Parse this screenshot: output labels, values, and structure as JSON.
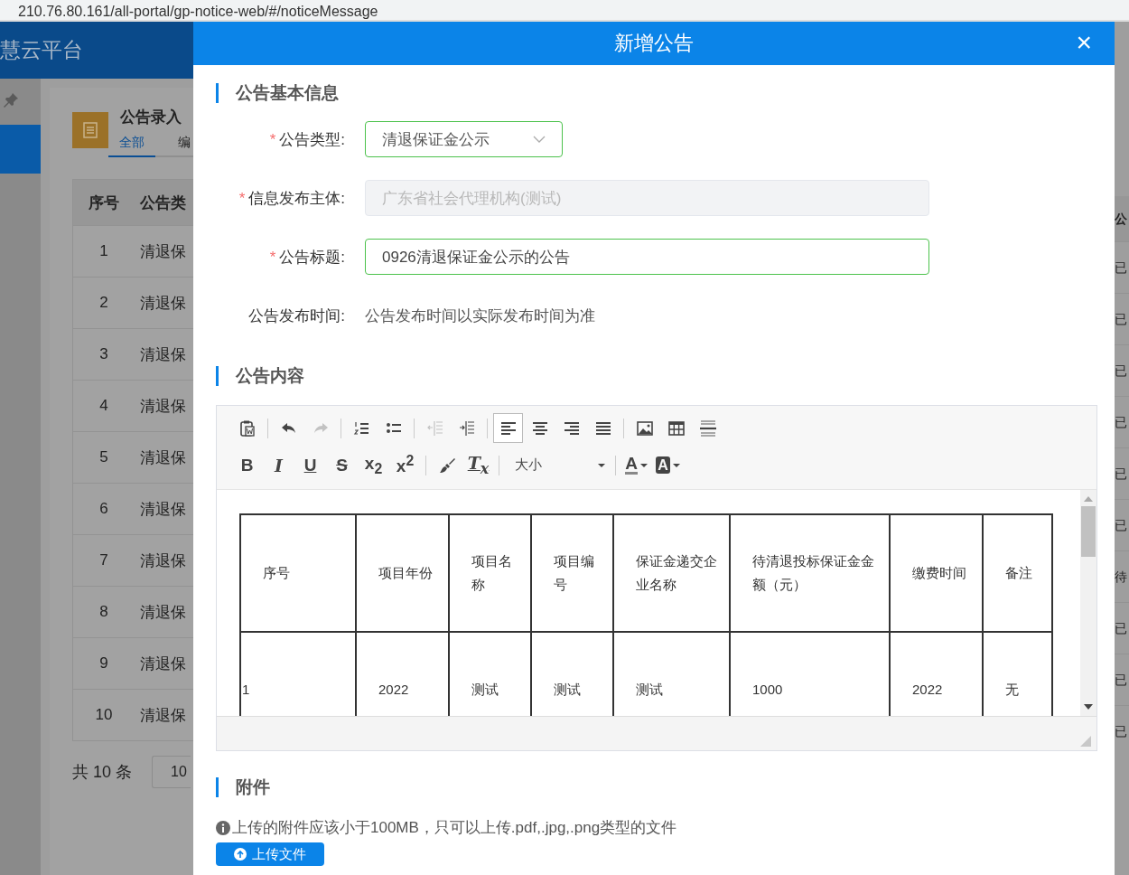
{
  "browser": {
    "url": "210.76.80.161/all-portal/gp-notice-web/#/noticeMessage"
  },
  "background": {
    "app_title": "慧云平台",
    "page_title": "公告录入",
    "tabs": [
      {
        "label": "全部",
        "selected": true
      },
      {
        "label": "编",
        "selected": false
      }
    ],
    "table": {
      "columns": [
        "序号",
        "公告类"
      ],
      "rows": [
        [
          "1",
          "清退保"
        ],
        [
          "2",
          "清退保"
        ],
        [
          "3",
          "清退保"
        ],
        [
          "4",
          "清退保"
        ],
        [
          "5",
          "清退保"
        ],
        [
          "6",
          "清退保"
        ],
        [
          "7",
          "清退保"
        ],
        [
          "8",
          "清退保"
        ],
        [
          "9",
          "清退保"
        ],
        [
          "10",
          "清退保"
        ]
      ],
      "right_column_header": "公",
      "right_column": [
        "已",
        "已",
        "已",
        "已",
        "已",
        "已",
        "待",
        "已",
        "已",
        "已"
      ]
    },
    "pagination": {
      "total": "共 10 条",
      "page_size": "10"
    }
  },
  "dialog": {
    "title": "新增公告",
    "close": "×",
    "sections": [
      "公告基本信息",
      "公告内容",
      "附件"
    ],
    "form": [
      {
        "kind": "select",
        "label": "公告类型:",
        "required_mark": "*",
        "value": "清退保证金公示"
      },
      {
        "kind": "disabled",
        "label": "信息发布主体:",
        "required_mark": "*",
        "value": "广东省社会代理机构(测试)"
      },
      {
        "kind": "input",
        "label": "公告标题:",
        "required_mark": "*",
        "value": "0926清退保证金公示的公告"
      },
      {
        "kind": "text",
        "label": "公告发布时间:",
        "value": "公告发布时间以实际发布时间为准"
      }
    ],
    "editor": {
      "toolbar": [
        [
          [
            {
              "kind": "paste-word",
              "selected": false,
              "disabled": false
            }
          ],
          [
            {
              "kind": "undo",
              "selected": false,
              "disabled": false
            },
            {
              "kind": "redo",
              "selected": false,
              "disabled": true
            }
          ],
          [
            {
              "kind": "ordered-list",
              "selected": false,
              "disabled": false
            },
            {
              "kind": "bullet-list",
              "selected": false,
              "disabled": false
            }
          ],
          [
            {
              "kind": "outdent",
              "selected": false,
              "disabled": true
            },
            {
              "kind": "indent",
              "selected": false,
              "disabled": false
            }
          ],
          [
            {
              "kind": "align-left",
              "selected": true,
              "disabled": false
            },
            {
              "kind": "align-center",
              "selected": false,
              "disabled": false
            },
            {
              "kind": "align-right",
              "selected": false,
              "disabled": false
            },
            {
              "kind": "justify",
              "selected": false,
              "disabled": false
            }
          ],
          [
            {
              "kind": "image",
              "selected": false,
              "disabled": false
            },
            {
              "kind": "table",
              "selected": false,
              "disabled": false
            },
            {
              "kind": "rule",
              "selected": false,
              "disabled": false
            }
          ]
        ],
        [
          [
            {
              "kind": "bold",
              "label": "B",
              "selected": false,
              "disabled": false
            },
            {
              "kind": "italic",
              "label": "I",
              "selected": false,
              "disabled": false
            },
            {
              "kind": "underline",
              "label": "U",
              "selected": false,
              "disabled": false
            },
            {
              "kind": "strike",
              "label": "S",
              "selected": false,
              "disabled": false
            },
            {
              "kind": "script",
              "label": "x$_{2}$",
              "selected": false,
              "disabled": false
            },
            {
              "kind": "script",
              "label": "x$^{2}$",
              "selected": false,
              "disabled": false
            }
          ],
          [
            {
              "kind": "brush",
              "selected": false,
              "disabled": false
            },
            {
              "kind": "clear",
              "label": "T$_{x}$",
              "selected": false,
              "disabled": false
            }
          ],
          [
            {
              "kind": "size",
              "label": "大小",
              "selected": false,
              "disabled": false
            }
          ],
          [
            {
              "kind": "text-color",
              "label": "A",
              "selected": false,
              "disabled": false
            },
            {
              "kind": "highlight",
              "label": "A",
              "selected": false,
              "disabled": false
            }
          ]
        ]
      ],
      "table": {
        "columns": [
          "序号",
          "项目年份",
          "项目名称",
          "项目编号",
          "保证金递交企业名称",
          "待清退投标保证金金额（元）",
          "缴费时间",
          "备注"
        ],
        "rows": [
          [
            "1",
            "2022",
            "测试",
            "测试",
            "测试",
            "1000",
            "2022",
            "无"
          ]
        ]
      }
    },
    "attachment_note": "上传的附件应该小于100MB，只可以上传.pdf,.jpg,.png类型的文件",
    "upload_button": "上传文件"
  }
}
